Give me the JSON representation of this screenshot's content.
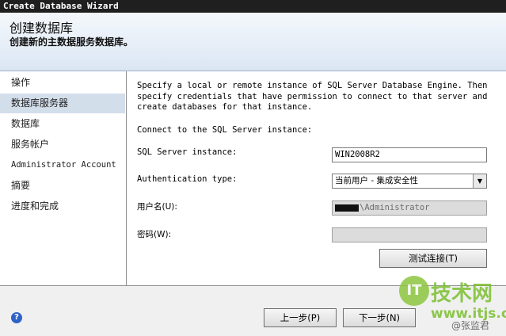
{
  "window": {
    "title": "Create Database Wizard"
  },
  "header": {
    "title": "创建数据库",
    "subtitle": "创建新的主数据服务数据库。"
  },
  "sidebar": {
    "items": [
      {
        "label": "操作"
      },
      {
        "label": "数据库服务器",
        "selected": true
      },
      {
        "label": "数据库"
      },
      {
        "label": "服务帐户"
      },
      {
        "label": "Administrator Account"
      },
      {
        "label": "摘要"
      },
      {
        "label": "进度和完成"
      }
    ]
  },
  "main": {
    "description": "Specify a local or remote instance of SQL Server Database Engine. Then specify credentials that have permission to connect to that server and create databases for that instance.",
    "connect_label": "Connect to the SQL Server instance:",
    "instance_label": "SQL Server instance:",
    "instance_value": "WIN2008R2",
    "auth_label": "Authentication type:",
    "auth_value": "当前用户 - 集成安全性",
    "username_label": "用户名(U):",
    "username_value": "\\Administrator",
    "password_label": "密码(W):",
    "password_value": "",
    "test_button": "测试连接(T)"
  },
  "footer": {
    "back_button": "上一步(P)",
    "next_button": "下一步(N)",
    "help_icon": "help-icon"
  },
  "watermark": {
    "line1": "技术网",
    "line2": "www.itjs.cn",
    "line3": "@张监君"
  }
}
